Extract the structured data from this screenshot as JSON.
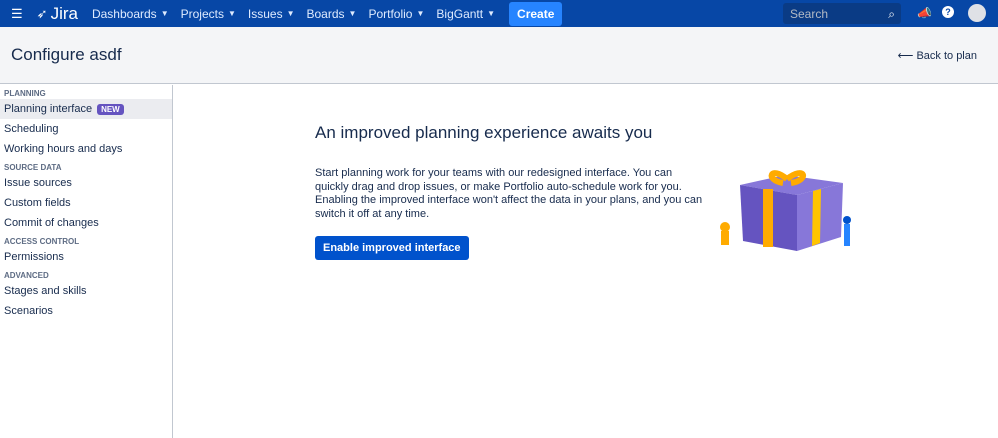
{
  "nav": {
    "app": "Jira",
    "items": [
      "Dashboards",
      "Projects",
      "Issues",
      "Boards",
      "Portfolio",
      "BigGantt"
    ],
    "create": "Create",
    "search_placeholder": "Search"
  },
  "header": {
    "title": "Configure asdf",
    "back": "Back to plan"
  },
  "sidebar": {
    "planning": "Planning",
    "planning_interface": "Planning interface",
    "new_badge": "NEW",
    "scheduling": "Scheduling",
    "working_hours": "Working hours and days",
    "source_data": "Source data",
    "issue_sources": "Issue sources",
    "custom_fields": "Custom fields",
    "commit": "Commit of changes",
    "access_control": "Access control",
    "permissions": "Permissions",
    "advanced": "Advanced",
    "stages": "Stages and skills",
    "scenarios": "Scenarios"
  },
  "main": {
    "title": "An improved planning experience awaits you",
    "body": "Start planning work for your teams with our redesigned interface. You can quickly drag and drop issues, or make Portfolio auto-schedule work for you. Enabling the improved interface won't affect the data in your plans, and you can switch it off at any time.",
    "button": "Enable improved interface"
  }
}
